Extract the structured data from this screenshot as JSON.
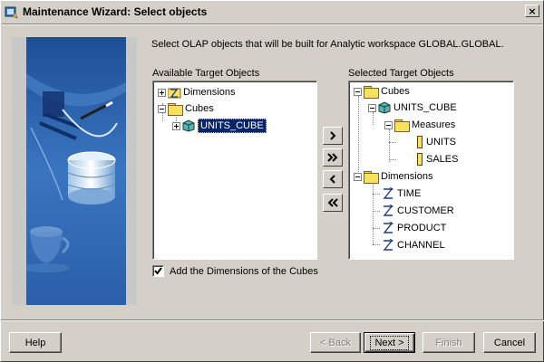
{
  "window": {
    "title": "Maintenance Wizard: Select objects",
    "close_label": "×"
  },
  "intro_text": "Select OLAP objects that will be built for Analytic workspace GLOBAL.GLOBAL.",
  "available": {
    "label": "Available Target Objects",
    "items": [
      {
        "label": "Dimensions",
        "icon": "dimension-folder-icon",
        "expanded": false
      },
      {
        "label": "Cubes",
        "icon": "folder-icon",
        "expanded": true
      },
      {
        "label": "UNITS_CUBE",
        "icon": "cube-icon",
        "expanded": false,
        "selected": true
      }
    ]
  },
  "move_buttons": {
    "move_right": "move-selected-right",
    "move_all_right": "move-all-right",
    "move_left": "move-selected-left",
    "move_all_left": "move-all-left"
  },
  "selected": {
    "label": "Selected Target Objects",
    "items": [
      {
        "label": "Cubes",
        "icon": "folder-icon"
      },
      {
        "label": "UNITS_CUBE",
        "icon": "cube-icon"
      },
      {
        "label": "Measures",
        "icon": "folder-icon"
      },
      {
        "label": "UNITS",
        "icon": "measure-icon"
      },
      {
        "label": "SALES",
        "icon": "measure-icon"
      },
      {
        "label": "Dimensions",
        "icon": "folder-icon"
      },
      {
        "label": "TIME",
        "icon": "dimension-icon"
      },
      {
        "label": "CUSTOMER",
        "icon": "dimension-icon"
      },
      {
        "label": "PRODUCT",
        "icon": "dimension-icon"
      },
      {
        "label": "CHANNEL",
        "icon": "dimension-icon"
      }
    ]
  },
  "checkbox": {
    "label": "Add the Dimensions of the Cubes",
    "checked": true
  },
  "buttons": {
    "help": "Help",
    "back": "< Back",
    "next": "Next >",
    "finish": "Finish",
    "cancel": "Cancel"
  },
  "colors": {
    "face": "#d4d0c8",
    "selection": "#0a246a",
    "folder": "#f8e060",
    "art_blue": "#2a5fa8"
  }
}
